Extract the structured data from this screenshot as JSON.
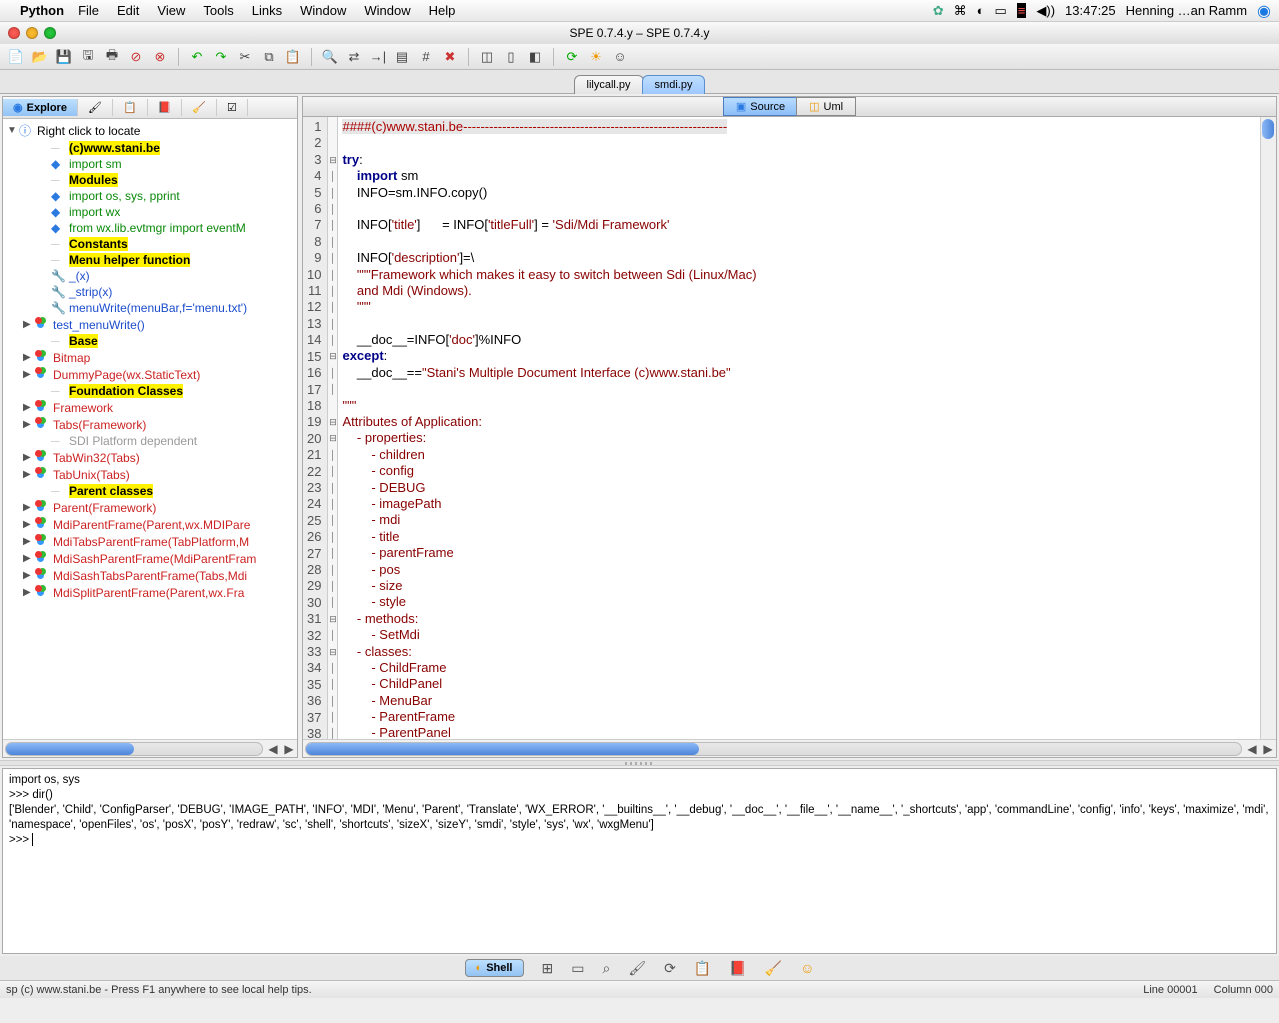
{
  "menubar": {
    "app": "Python",
    "items": [
      "File",
      "Edit",
      "View",
      "Tools",
      "Links",
      "Window",
      "Window",
      "Help"
    ],
    "time": "13:47:25",
    "user": "Henning …an Ramm"
  },
  "window_title": "SPE 0.7.4.y – SPE 0.7.4.y",
  "file_tabs": [
    {
      "label": "lilycall.py",
      "active": false
    },
    {
      "label": "smdi.py",
      "active": true
    }
  ],
  "left_tabs": {
    "active": "Explore"
  },
  "tree": {
    "root": "Right click to locate",
    "items": [
      {
        "icon": "",
        "label": "(c)www.stani.be",
        "cls": "hl-yellow",
        "indent": 2
      },
      {
        "icon": "import",
        "label": "import sm",
        "cls": "txt-green",
        "indent": 2
      },
      {
        "icon": "",
        "label": "Modules",
        "cls": "hl-yellow",
        "indent": 2
      },
      {
        "icon": "import",
        "label": "import  os, sys, pprint",
        "cls": "txt-green",
        "indent": 2
      },
      {
        "icon": "import",
        "label": "import  wx",
        "cls": "txt-green",
        "indent": 2
      },
      {
        "icon": "import",
        "label": "from    wx.lib.evtmgr import eventM",
        "cls": "txt-green",
        "indent": 2
      },
      {
        "icon": "",
        "label": "Constants",
        "cls": "hl-yellow",
        "indent": 2
      },
      {
        "icon": "",
        "label": "Menu helper function",
        "cls": "hl-yellow",
        "indent": 2
      },
      {
        "icon": "wrench",
        "label": "_(x)",
        "cls": "txt-blue",
        "indent": 2
      },
      {
        "icon": "wrench",
        "label": "_strip(x)",
        "cls": "txt-blue",
        "indent": 2
      },
      {
        "icon": "wrench",
        "label": "menuWrite(menuBar,f='menu.txt')",
        "cls": "txt-blue",
        "indent": 2
      },
      {
        "icon": "rgb",
        "label": "test_menuWrite()",
        "cls": "txt-blue",
        "indent": 1,
        "arrow": "▶"
      },
      {
        "icon": "",
        "label": "Base",
        "cls": "hl-yellow",
        "indent": 2
      },
      {
        "icon": "rgb",
        "label": "Bitmap",
        "cls": "txt-red",
        "indent": 1,
        "arrow": "▶"
      },
      {
        "icon": "rgb",
        "label": "DummyPage(wx.StaticText)",
        "cls": "txt-red",
        "indent": 1,
        "arrow": "▶"
      },
      {
        "icon": "",
        "label": "Foundation Classes",
        "cls": "hl-yellow",
        "indent": 2
      },
      {
        "icon": "rgb",
        "label": "Framework",
        "cls": "txt-red",
        "indent": 1,
        "arrow": "▶"
      },
      {
        "icon": "rgb",
        "label": "Tabs(Framework)",
        "cls": "txt-red",
        "indent": 1,
        "arrow": "▶"
      },
      {
        "icon": "",
        "label": "SDI Platform dependent",
        "cls": "txt-gray",
        "indent": 2
      },
      {
        "icon": "rgb",
        "label": "TabWin32(Tabs)",
        "cls": "txt-red",
        "indent": 1,
        "arrow": "▶"
      },
      {
        "icon": "rgb",
        "label": "TabUnix(Tabs)",
        "cls": "txt-red",
        "indent": 1,
        "arrow": "▶"
      },
      {
        "icon": "",
        "label": "Parent classes",
        "cls": "hl-yellow",
        "indent": 2
      },
      {
        "icon": "rgb",
        "label": "Parent(Framework)",
        "cls": "txt-red",
        "indent": 1,
        "arrow": "▶"
      },
      {
        "icon": "rgb",
        "label": "MdiParentFrame(Parent,wx.MDIPare",
        "cls": "txt-red",
        "indent": 1,
        "arrow": "▶"
      },
      {
        "icon": "rgb",
        "label": "MdiTabsParentFrame(TabPlatform,M",
        "cls": "txt-red",
        "indent": 1,
        "arrow": "▶"
      },
      {
        "icon": "rgb",
        "label": "MdiSashParentFrame(MdiParentFram",
        "cls": "txt-red",
        "indent": 1,
        "arrow": "▶"
      },
      {
        "icon": "rgb",
        "label": "MdiSashTabsParentFrame(Tabs,Mdi",
        "cls": "txt-red",
        "indent": 1,
        "arrow": "▶"
      },
      {
        "icon": "rgb",
        "label": "MdiSplitParentFrame(Parent,wx.Fra",
        "cls": "txt-red",
        "indent": 1,
        "arrow": "▶"
      }
    ]
  },
  "editor_tabs": [
    {
      "label": "Source",
      "active": true
    },
    {
      "label": "Uml",
      "active": false
    }
  ],
  "code": {
    "lines": [
      {
        "n": 1,
        "fold": "",
        "raw": "<span class='cm sel-line'>####(c)www.stani.be-------------------------------------------------------------</span>"
      },
      {
        "n": 2,
        "fold": "",
        "raw": ""
      },
      {
        "n": 3,
        "fold": "⊟",
        "raw": "<span class='kw'>try</span>:"
      },
      {
        "n": 4,
        "fold": "│",
        "raw": "    <span class='kw'>import</span> sm"
      },
      {
        "n": 5,
        "fold": "│",
        "raw": "    INFO=sm.INFO.copy()"
      },
      {
        "n": 6,
        "fold": "│",
        "raw": ""
      },
      {
        "n": 7,
        "fold": "│",
        "raw": "    INFO[<span class='str'>'title'</span>]      = INFO[<span class='str'>'titleFull'</span>] = <span class='str'>'Sdi/Mdi Framework'</span>"
      },
      {
        "n": 8,
        "fold": "│",
        "raw": ""
      },
      {
        "n": 9,
        "fold": "│",
        "raw": "    INFO[<span class='str'>'description'</span>]=\\"
      },
      {
        "n": 10,
        "fold": "│",
        "raw": "    <span class='str'>\"\"\"Framework which makes it easy to switch between Sdi (Linux/Mac)</span>"
      },
      {
        "n": 11,
        "fold": "│",
        "raw": "<span class='str'>    and Mdi (Windows).</span>"
      },
      {
        "n": 12,
        "fold": "│",
        "raw": "<span class='str'>    \"\"\"</span>"
      },
      {
        "n": 13,
        "fold": "│",
        "raw": ""
      },
      {
        "n": 14,
        "fold": "│",
        "raw": "    __doc__=INFO[<span class='str'>'doc'</span>]%INFO"
      },
      {
        "n": 15,
        "fold": "⊟",
        "raw": "<span class='kw'>except</span>:"
      },
      {
        "n": 16,
        "fold": "│",
        "raw": "    __doc__==<span class='str'>\"Stani's Multiple Document Interface (c)www.stani.be\"</span>"
      },
      {
        "n": 17,
        "fold": "│",
        "raw": ""
      },
      {
        "n": 18,
        "fold": "",
        "raw": "<span class='str'>\"\"\"</span>"
      },
      {
        "n": 19,
        "fold": "⊟",
        "raw": "<span class='str'>Attributes of Application:</span>"
      },
      {
        "n": 20,
        "fold": "⊟",
        "raw": "<span class='str'>    - properties:</span>"
      },
      {
        "n": 21,
        "fold": "│",
        "raw": "<span class='str'>        - children</span>"
      },
      {
        "n": 22,
        "fold": "│",
        "raw": "<span class='str'>        - config</span>"
      },
      {
        "n": 23,
        "fold": "│",
        "raw": "<span class='str'>        - DEBUG</span>"
      },
      {
        "n": 24,
        "fold": "│",
        "raw": "<span class='str'>        - imagePath</span>"
      },
      {
        "n": 25,
        "fold": "│",
        "raw": "<span class='str'>        - mdi</span>"
      },
      {
        "n": 26,
        "fold": "│",
        "raw": "<span class='str'>        - title</span>"
      },
      {
        "n": 27,
        "fold": "│",
        "raw": "<span class='str'>        - parentFrame</span>"
      },
      {
        "n": 28,
        "fold": "│",
        "raw": "<span class='str'>        - pos</span>"
      },
      {
        "n": 29,
        "fold": "│",
        "raw": "<span class='str'>        - size</span>"
      },
      {
        "n": 30,
        "fold": "│",
        "raw": "<span class='str'>        - style</span>"
      },
      {
        "n": 31,
        "fold": "⊟",
        "raw": "<span class='str'>    - methods:</span>"
      },
      {
        "n": 32,
        "fold": "│",
        "raw": "<span class='str'>        - SetMdi</span>"
      },
      {
        "n": 33,
        "fold": "⊟",
        "raw": "<span class='str'>    - classes:</span>"
      },
      {
        "n": 34,
        "fold": "│",
        "raw": "<span class='str'>        - ChildFrame</span>"
      },
      {
        "n": 35,
        "fold": "│",
        "raw": "<span class='str'>        - ChildPanel</span>"
      },
      {
        "n": 36,
        "fold": "│",
        "raw": "<span class='str'>        - MenuBar</span>"
      },
      {
        "n": 37,
        "fold": "│",
        "raw": "<span class='str'>        - ParentFrame</span>"
      },
      {
        "n": 38,
        "fold": "│",
        "raw": "<span class='str'>        - ParentPanel</span>"
      }
    ]
  },
  "console": {
    "lines": [
      "import os, sys",
      ">>> dir()",
      "['Blender', 'Child', 'ConfigParser', 'DEBUG', 'IMAGE_PATH', 'INFO', 'MDI', 'Menu', 'Parent', 'Translate', 'WX_ERROR', '__builtins__', '__debug', '__doc__', '__file__', '__name__', '_shortcuts', 'app', 'commandLine', 'config', 'info', 'keys', 'maximize', 'mdi', 'namespace', 'openFiles', 'os', 'posX', 'posY', 'redraw', 'sc', 'shell', 'shortcuts', 'sizeX', 'sizeY', 'smdi', 'style', 'sys', 'wx', 'wxgMenu']",
      ">>> "
    ]
  },
  "bottom_tabs": {
    "active": "Shell"
  },
  "statusbar": {
    "left": "sp  (c) www.stani.be - Press F1 anywhere to see local help tips.",
    "line": "Line 00001",
    "col": "Column 000"
  }
}
